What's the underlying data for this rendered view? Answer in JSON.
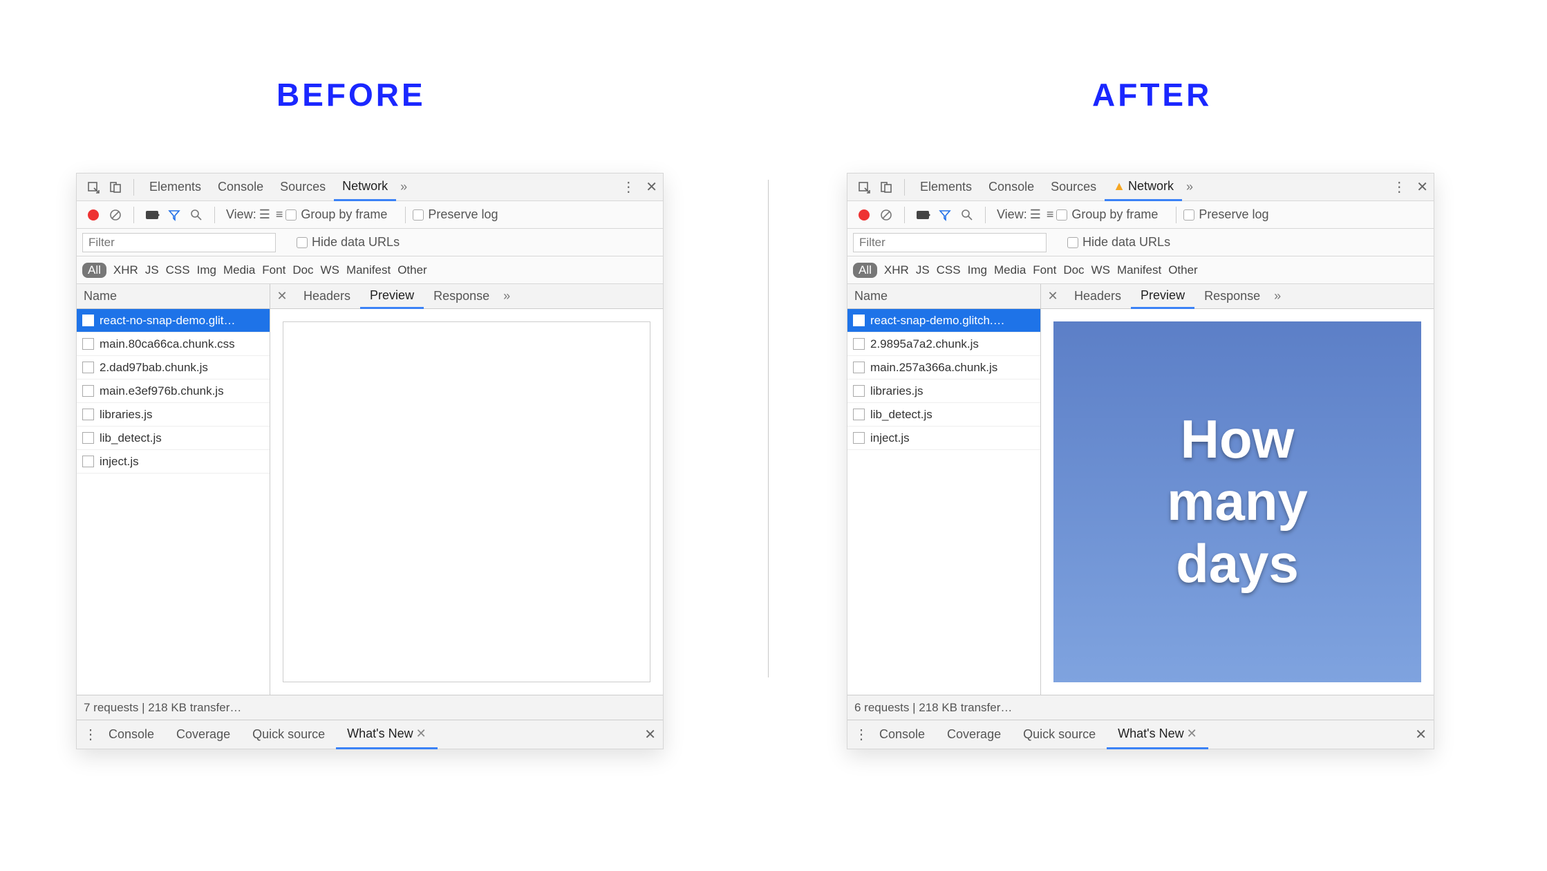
{
  "labels": {
    "before": "BEFORE",
    "after": "AFTER"
  },
  "topTabs": [
    "Elements",
    "Console",
    "Sources",
    "Network"
  ],
  "toolbar": {
    "viewLabel": "View:",
    "groupByFrame": "Group by frame",
    "preserveLog": "Preserve log",
    "filterPlaceholder": "Filter",
    "hideDataUrls": "Hide data URLs"
  },
  "typeFilters": [
    "All",
    "XHR",
    "JS",
    "CSS",
    "Img",
    "Media",
    "Font",
    "Doc",
    "WS",
    "Manifest",
    "Other"
  ],
  "columns": {
    "name": "Name",
    "headers": "Headers",
    "preview": "Preview",
    "response": "Response"
  },
  "before": {
    "requests": [
      "react-no-snap-demo.glit…",
      "main.80ca66ca.chunk.css",
      "2.dad97bab.chunk.js",
      "main.e3ef976b.chunk.js",
      "libraries.js",
      "lib_detect.js",
      "inject.js"
    ],
    "status": "7 requests | 218 KB transfer…",
    "previewLines": []
  },
  "after": {
    "requests": [
      "react-snap-demo.glitch.…",
      "2.9895a7a2.chunk.js",
      "main.257a366a.chunk.js",
      "libraries.js",
      "lib_detect.js",
      "inject.js"
    ],
    "status": "6 requests | 218 KB transfer…",
    "previewLines": [
      "How",
      "many",
      "days"
    ],
    "hasWarning": true
  },
  "drawer": {
    "tabs": [
      "Console",
      "Coverage",
      "Quick source",
      "What's New"
    ],
    "activeTab": "What's New"
  }
}
